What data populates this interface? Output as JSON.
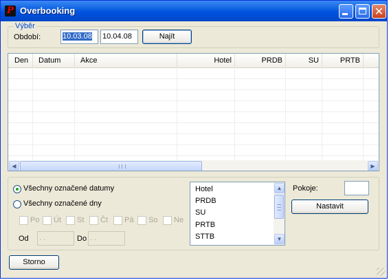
{
  "window": {
    "title": "Overbooking",
    "app_icon_letter": "P",
    "controls": [
      "minimize-icon",
      "maximize-icon",
      "close-icon"
    ]
  },
  "filter": {
    "legend": "Výběr",
    "period_label": "Období:",
    "date_from": "10.03.08",
    "date_to": "10.04.08",
    "find_button": "Najít"
  },
  "table": {
    "columns": [
      "Den",
      "Datum",
      "Akce",
      "Hotel",
      "PRDB",
      "SU",
      "PRTB"
    ],
    "rows": []
  },
  "options": {
    "radio_all_dates": "Všechny označené datumy",
    "radio_all_days": "Všechny označené dny",
    "selected_radio": "radio_all_dates",
    "days": [
      "Po",
      "Út",
      "St",
      "Čt",
      "Pá",
      "So",
      "Ne"
    ],
    "od_label": "Od",
    "od_value": " .  .",
    "do_label": "Do",
    "do_value": " .  ."
  },
  "room_types": [
    "Hotel",
    "PRDB",
    "SU",
    "PRTB",
    "STTB"
  ],
  "rooms": {
    "label": "Pokoje:",
    "value": "",
    "set_button": "Nastavit"
  },
  "footer": {
    "cancel_button": "Storno"
  },
  "colors": {
    "titlebar": "#0a5de0",
    "window_bg": "#ece9d8",
    "accent_text": "#0046d5",
    "selection": "#316ac5"
  }
}
